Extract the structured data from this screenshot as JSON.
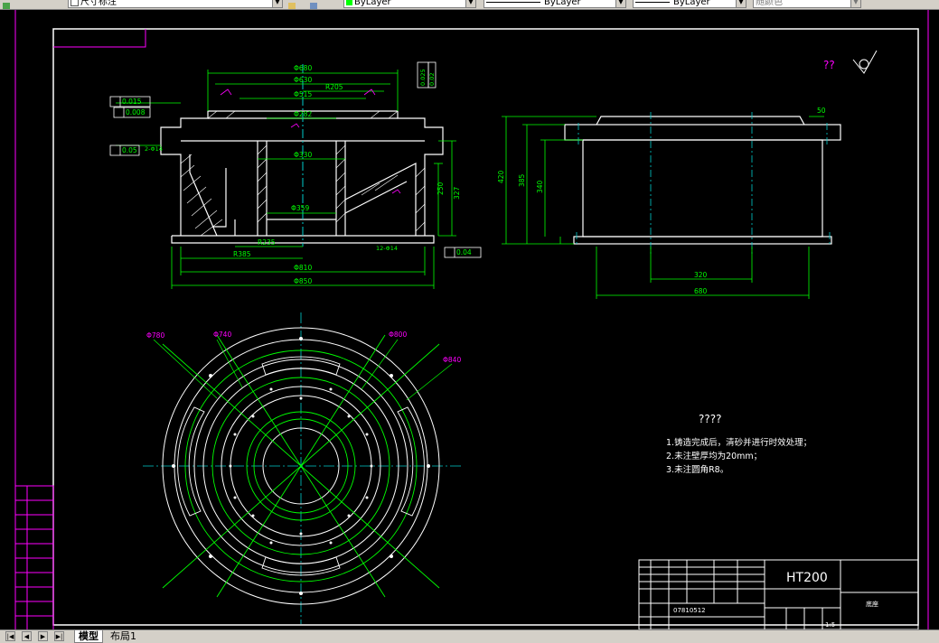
{
  "toolbar": {
    "dimstyle": "尺寸标注",
    "color": "ByLayer",
    "linetype": "ByLayer",
    "lineweight": "ByLayer",
    "plotstyle": "随颜色"
  },
  "drawing": {
    "front_view_dims": {
      "d680": "Φ680",
      "d630": "Φ630",
      "d515": "Φ515",
      "r205": "R205",
      "d282": "Φ282",
      "d330": "Φ330",
      "d359": "Φ359",
      "r235": "R235",
      "r385": "R385",
      "d810": "Φ810",
      "d850": "Φ850",
      "h250": "250",
      "h327": "327",
      "tol1": "0.015",
      "tol2": "0.008",
      "tol3": "0.05",
      "tol4": "0.04",
      "tol5": "0.025",
      "tol6": "0.02",
      "note_holes1": "12-Φ14",
      "note_holes2": "2-Φ14"
    },
    "side_view_dims": {
      "h420": "420",
      "h385": "385",
      "h340": "340",
      "w320": "320",
      "w680": "680",
      "t50": "50"
    },
    "plan_view_dims": {
      "d780": "Φ780",
      "d740": "Φ740",
      "d800": "Φ800",
      "d840": "Φ840"
    },
    "roughness_mark": "??",
    "tech_req": {
      "title": "????",
      "item1": "1.铸造完成后，清砂并进行时效处理；",
      "item2": "2.未注壁厚均为20mm；",
      "item3": "3.未注圆角R8。"
    },
    "title_block": {
      "material": "HT200",
      "scale": "1:5",
      "part_name": "底座",
      "code": "07810512"
    }
  },
  "tabs": {
    "model": "模型",
    "layout1": "布局1"
  },
  "colors": {
    "frame": "#ffffff",
    "outline": "#ffffff",
    "dimension": "#00ff00",
    "centerline": "#00cccc",
    "annotation": "#ff00ff",
    "background": "#000000"
  }
}
